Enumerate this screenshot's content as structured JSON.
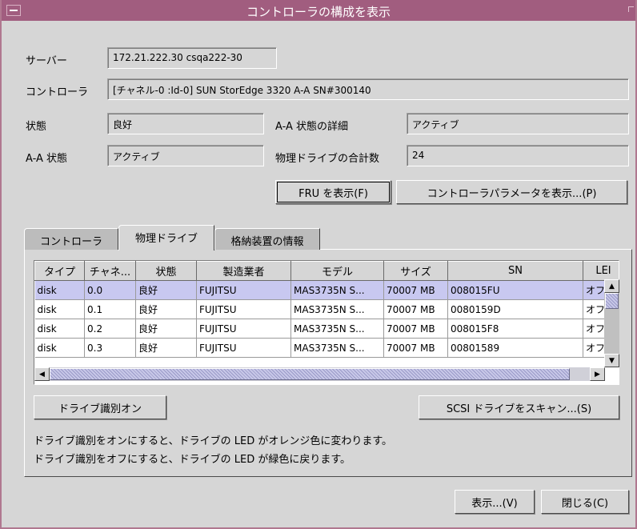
{
  "window": {
    "title": "コントローラの構成を表示"
  },
  "fields": {
    "server_label": "サーバー",
    "server_value": "172.21.222.30 csqa222-30",
    "controller_label": "コントローラ",
    "controller_value": "[チャネル-0 :Id-0] SUN StorEdge 3320 A-A SN#300140",
    "status_label": "状態",
    "status_value": "良好",
    "aa_detail_label": "A-A 状態の詳細",
    "aa_detail_value": "アクティブ",
    "aa_status_label": "A-A 状態",
    "aa_status_value": "アクティブ",
    "drive_total_label": "物理ドライブの合計数",
    "drive_total_value": "24"
  },
  "buttons": {
    "show_fru": "FRU を表示(F)",
    "show_ctrl_params": "コントローラパラメータを表示...(P)",
    "drive_identify_on": "ドライブ識別オン",
    "scan_scsi": "SCSI ドライブをスキャン...(S)",
    "view": "表示...(V)",
    "close": "閉じる(C)"
  },
  "tabs": [
    {
      "label": "コントローラ"
    },
    {
      "label": "物理ドライブ"
    },
    {
      "label": "格納装置の情報"
    }
  ],
  "table": {
    "columns": [
      "タイプ",
      "チャネ...",
      "状態",
      "製造業者",
      "モデル",
      "サイズ",
      "SN",
      "LEI"
    ],
    "rows": [
      [
        "disk",
        "0.0",
        "良好",
        "FUJITSU",
        "MAS3735N S...",
        "70007 MB",
        "008015FU",
        "オフ"
      ],
      [
        "disk",
        "0.1",
        "良好",
        "FUJITSU",
        "MAS3735N S...",
        "70007 MB",
        "0080159D",
        "オフ"
      ],
      [
        "disk",
        "0.2",
        "良好",
        "FUJITSU",
        "MAS3735N S...",
        "70007 MB",
        "008015F8",
        "オフ"
      ],
      [
        "disk",
        "0.3",
        "良好",
        "FUJITSU",
        "MAS3735N S...",
        "70007 MB",
        "00801589",
        "オフ"
      ]
    ],
    "selected_row": 0
  },
  "notes": [
    "ドライブ識別をオンにすると、ドライブの LED がオレンジ色に変わります。",
    "ドライブ識別をオフにすると、ドライブの LED が緑色に戻ります。"
  ],
  "icons": {
    "window_menu": "window-menu-icon",
    "maximize": "maximize-icon",
    "scroll_up": "arrow-up-icon",
    "scroll_down": "arrow-down-icon",
    "scroll_left": "arrow-left-icon",
    "scroll_right": "arrow-right-icon"
  },
  "colors": {
    "titlebar": "#a15d7f",
    "selection": "#c8c8f0",
    "dialog_bg": "#d6d6d6"
  }
}
